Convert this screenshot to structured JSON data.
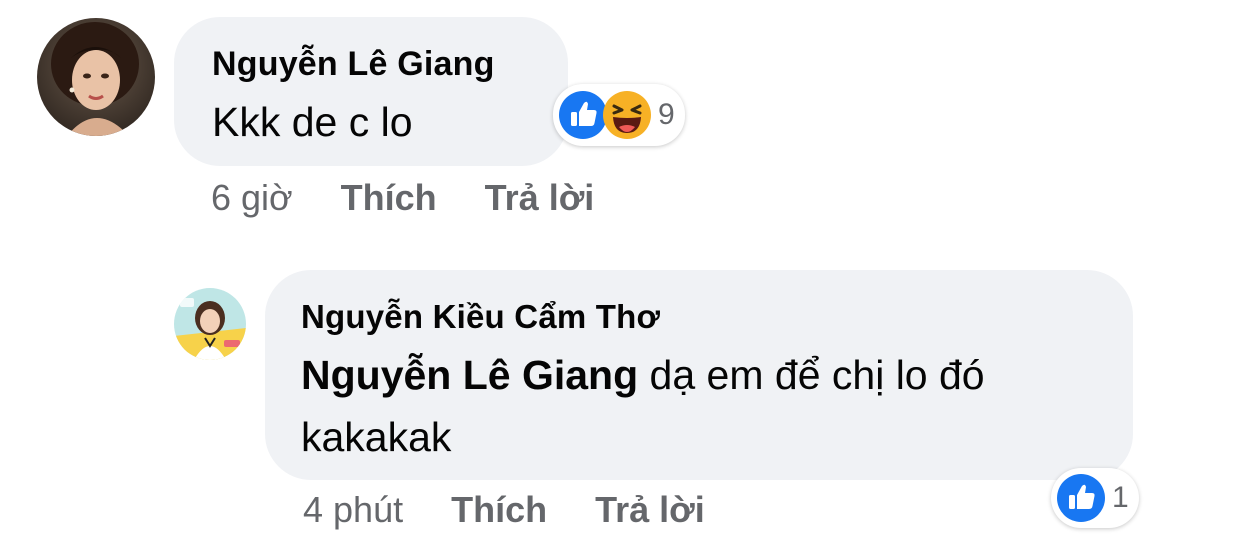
{
  "comments": [
    {
      "author": "Nguyễn Lê Giang",
      "text": "Kkk de c lo",
      "time": "6 giờ",
      "like_label": "Thích",
      "reply_label": "Trả lời",
      "reaction_count": "9",
      "reactions": [
        "like-icon",
        "haha-icon"
      ]
    },
    {
      "author": "Nguyễn Kiều Cẩm Thơ",
      "mention": "Nguyễn Lê Giang",
      "text": " dạ em để chị lo đó kakakak",
      "time": "4 phút",
      "like_label": "Thích",
      "reply_label": "Trả lời",
      "reaction_count": "1",
      "reactions": [
        "like-icon"
      ]
    }
  ],
  "colors": {
    "bubble_bg": "#f0f2f5",
    "meta_text": "#65676b",
    "like_blue": "#1877f2",
    "haha_yellow": "#f7b125"
  }
}
